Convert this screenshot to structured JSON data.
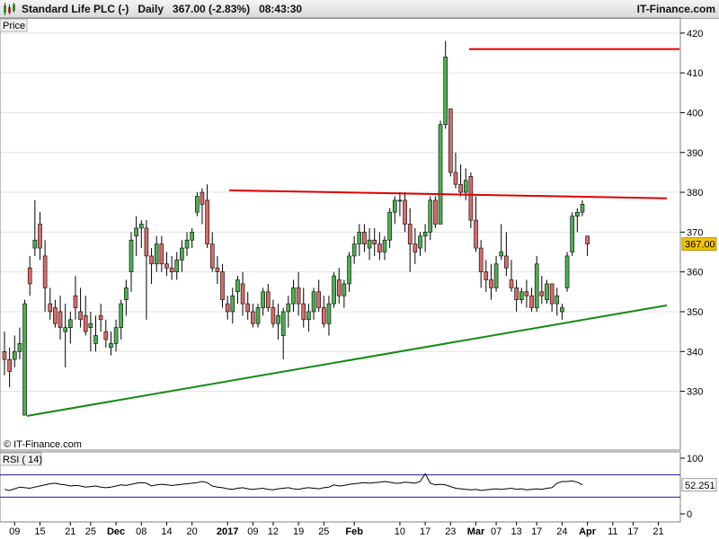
{
  "header": {
    "title": "Standard Life PLC (-)   Daily   367.00 (-2.83%)   08:43:30",
    "brand": "IT-Finance.com"
  },
  "colors": {
    "up": "#4caf50",
    "down": "#d96a6a",
    "wick": "#000000",
    "resistance": "#e00000",
    "support": "#138a13",
    "rsi_line": "#000000",
    "rsi_bounds": "#1a1aa0",
    "price_badge": "#f0c400",
    "grid": "#e3e3e3"
  },
  "chart_data": [
    {
      "type": "candlestick",
      "title": "Standard Life PLC (-)",
      "panel_label": "Price",
      "watermark": "© IT-Finance.com",
      "last_price_label": "367.00",
      "ylim": [
        322,
        422
      ],
      "y_ticks": [
        330,
        340,
        350,
        360,
        370,
        380,
        390,
        400,
        410,
        420
      ],
      "x_tick_labels": [
        "09",
        "15",
        "21",
        "25",
        "Dec",
        "08",
        "14",
        "20",
        "2017",
        "09",
        "12",
        "19",
        "25",
        "Feb",
        "10",
        "17",
        "23",
        "Mar",
        "07",
        "13",
        "17",
        "24",
        "Apr",
        "11",
        "17",
        "21"
      ],
      "x_tick_bold": [
        "Dec",
        "2017",
        "Feb",
        "Mar",
        "Apr"
      ],
      "x_tick_index": [
        2,
        7,
        13,
        17,
        22,
        27,
        32,
        37,
        44,
        49,
        53,
        58,
        63,
        69,
        78,
        83,
        88,
        93,
        97,
        101,
        105,
        110,
        115,
        120,
        124,
        129
      ],
      "ohlc": [
        [
          340,
          345,
          334,
          338
        ],
        [
          338,
          341,
          331,
          335
        ],
        [
          338,
          344,
          336,
          340
        ],
        [
          340,
          346,
          338,
          342
        ],
        [
          324,
          353,
          324,
          352
        ],
        [
          361,
          364,
          354,
          357
        ],
        [
          366,
          378,
          364,
          368
        ],
        [
          372,
          375,
          363,
          366
        ],
        [
          364,
          368,
          350,
          356
        ],
        [
          352,
          356,
          348,
          350
        ],
        [
          351,
          353,
          346,
          347
        ],
        [
          350,
          354,
          343,
          346
        ],
        [
          345,
          352,
          336,
          346
        ],
        [
          346,
          350,
          342,
          348
        ],
        [
          354,
          359,
          348,
          351
        ],
        [
          350,
          356,
          346,
          348
        ],
        [
          349,
          354,
          344,
          345
        ],
        [
          346,
          350,
          340,
          347
        ],
        [
          342,
          349,
          340,
          344
        ],
        [
          349,
          352,
          345,
          348
        ],
        [
          345,
          348,
          341,
          343
        ],
        [
          341,
          345,
          339,
          342
        ],
        [
          342,
          348,
          340,
          346
        ],
        [
          346,
          353,
          343,
          352
        ],
        [
          353,
          358,
          349,
          356
        ],
        [
          360,
          370,
          355,
          368
        ],
        [
          369,
          374,
          364,
          371
        ],
        [
          371,
          373,
          366,
          372
        ],
        [
          371,
          373,
          348,
          364
        ],
        [
          364,
          366,
          357,
          362
        ],
        [
          362,
          369,
          360,
          367
        ],
        [
          367,
          369,
          360,
          362
        ],
        [
          362,
          365,
          359,
          361
        ],
        [
          361,
          364,
          358,
          360
        ],
        [
          360,
          365,
          358,
          363
        ],
        [
          363,
          368,
          360,
          366
        ],
        [
          366,
          370,
          364,
          368
        ],
        [
          368,
          371,
          366,
          370
        ],
        [
          375,
          380,
          374,
          379
        ],
        [
          380,
          381,
          372,
          377
        ],
        [
          378,
          382,
          366,
          367
        ],
        [
          367,
          370,
          360,
          361
        ],
        [
          361,
          364,
          357,
          360
        ],
        [
          360,
          362,
          351,
          353
        ],
        [
          352,
          354,
          348,
          350
        ],
        [
          350,
          356,
          347,
          354
        ],
        [
          355,
          359,
          352,
          358
        ],
        [
          357,
          360,
          349,
          352
        ],
        [
          352,
          355,
          348,
          350
        ],
        [
          350,
          352,
          346,
          347
        ],
        [
          347,
          352,
          346,
          351
        ],
        [
          351,
          356,
          349,
          355
        ],
        [
          355,
          357,
          350,
          351
        ],
        [
          351,
          353,
          346,
          347
        ],
        [
          347,
          352,
          343,
          349
        ],
        [
          344,
          351,
          338,
          350
        ],
        [
          350,
          354,
          346,
          352
        ],
        [
          352,
          358,
          350,
          356
        ],
        [
          356,
          360,
          349,
          352
        ],
        [
          352,
          356,
          346,
          348
        ],
        [
          348,
          352,
          345,
          350
        ],
        [
          350,
          356,
          348,
          355
        ],
        [
          355,
          358,
          350,
          351
        ],
        [
          351,
          354,
          346,
          347
        ],
        [
          347,
          354,
          344,
          352
        ],
        [
          352,
          360,
          351,
          359
        ],
        [
          358,
          361,
          352,
          354
        ],
        [
          354,
          358,
          351,
          357
        ],
        [
          357,
          365,
          355,
          364
        ],
        [
          364,
          369,
          362,
          367
        ],
        [
          367,
          372,
          364,
          370
        ],
        [
          370,
          372,
          365,
          367
        ],
        [
          366,
          371,
          363,
          368
        ],
        [
          368,
          371,
          364,
          367
        ],
        [
          367,
          370,
          363,
          365
        ],
        [
          365,
          369,
          363,
          368
        ],
        [
          368,
          376,
          366,
          375
        ],
        [
          375,
          379,
          372,
          378
        ],
        [
          378,
          380,
          374,
          378
        ],
        [
          378,
          380,
          370,
          372
        ],
        [
          372,
          376,
          360,
          367
        ],
        [
          367,
          371,
          362,
          365
        ],
        [
          366,
          370,
          364,
          369
        ],
        [
          369,
          372,
          365,
          370
        ],
        [
          370,
          379,
          368,
          378
        ],
        [
          378,
          379,
          371,
          372
        ],
        [
          372,
          398,
          372,
          397
        ],
        [
          397,
          418,
          396,
          414
        ],
        [
          401,
          401,
          384,
          385
        ],
        [
          385,
          390,
          381,
          382
        ],
        [
          382,
          387,
          379,
          380
        ],
        [
          380,
          386,
          378,
          383
        ],
        [
          384,
          385,
          371,
          373
        ],
        [
          373,
          379,
          365,
          366
        ],
        [
          366,
          368,
          356,
          360
        ],
        [
          360,
          363,
          355,
          358
        ],
        [
          358,
          362,
          353,
          356
        ],
        [
          356,
          364,
          355,
          362
        ],
        [
          364,
          372,
          363,
          365
        ],
        [
          364,
          370,
          359,
          361
        ],
        [
          358,
          363,
          355,
          356
        ],
        [
          356,
          358,
          350,
          353
        ],
        [
          353,
          356,
          352,
          355
        ],
        [
          355,
          358,
          351,
          354
        ],
        [
          354,
          356,
          350,
          351
        ],
        [
          351,
          364,
          350,
          362
        ],
        [
          355,
          359,
          352,
          354
        ],
        [
          353,
          358,
          352,
          357
        ],
        [
          357,
          357,
          350,
          352
        ],
        [
          352,
          356,
          349,
          354
        ],
        [
          350,
          352,
          348,
          351
        ],
        [
          356,
          365,
          355,
          364
        ],
        [
          365,
          375,
          364,
          374
        ],
        [
          374,
          376,
          370,
          375
        ],
        [
          375,
          378,
          374,
          377
        ],
        [
          369,
          368,
          364,
          367
        ]
      ],
      "resistance_line": {
        "x": [
          "21 Dec",
          "28 Apr"
        ],
        "y": [
          380.5,
          378.5
        ]
      },
      "support_line": {
        "x": [
          "10 Nov",
          "28 Apr"
        ],
        "y": [
          323.8,
          351.6
        ]
      },
      "top_line": {
        "x": [
          "06 Mar",
          "28 Apr"
        ],
        "y": [
          416,
          416
        ]
      }
    },
    {
      "type": "line",
      "title": "RSI ( 14)",
      "ylim": [
        0,
        100
      ],
      "y_ticks": [
        0,
        100
      ],
      "bounds": [
        70,
        30
      ],
      "last_value_label": "52.251",
      "values": [
        44,
        42,
        45,
        48,
        47,
        46,
        48,
        50,
        52,
        54,
        55,
        53,
        52,
        50,
        51,
        50,
        48,
        49,
        50,
        48,
        47,
        48,
        50,
        52,
        51,
        53,
        55,
        56,
        55,
        50,
        52,
        53,
        52,
        51,
        52,
        53,
        54,
        55,
        56,
        58,
        56,
        50,
        48,
        47,
        45,
        44,
        46,
        47,
        45,
        44,
        45,
        46,
        44,
        43,
        45,
        46,
        47,
        45,
        44,
        46,
        47,
        46,
        45,
        47,
        48,
        52,
        50,
        51,
        53,
        54,
        55,
        56,
        55,
        56,
        57,
        58,
        57,
        55,
        55,
        57,
        56,
        55,
        58,
        72,
        55,
        52,
        53,
        52,
        49,
        46,
        45,
        44,
        43,
        44,
        42,
        43,
        44,
        45,
        44,
        45,
        46,
        44,
        45,
        43,
        44,
        45,
        44,
        46,
        47,
        55,
        58,
        58,
        59,
        57,
        52
      ]
    }
  ]
}
